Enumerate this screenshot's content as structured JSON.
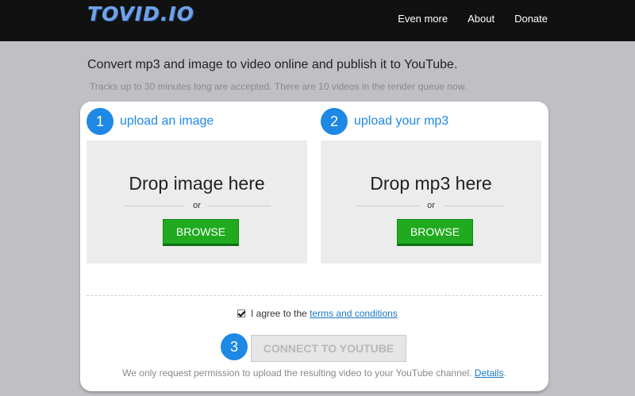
{
  "header": {
    "logo": "TOVID.IO",
    "nav": [
      "Even more",
      "About",
      "Donate"
    ]
  },
  "intro": {
    "headline": "Convert mp3 and image to video online and publish it to YouTube.",
    "subline": "Tracks up to 30 minutes long are accepted. There are 10 videos in the render queue now."
  },
  "steps": {
    "image": {
      "number": "1",
      "label": "upload an image",
      "drop_text": "Drop image here",
      "or": "or",
      "browse": "BROWSE"
    },
    "mp3": {
      "number": "2",
      "label": "upload your mp3",
      "drop_text": "Drop mp3 here",
      "or": "or",
      "browse": "BROWSE"
    },
    "publish": {
      "number": "3",
      "button": "CONNECT TO YOUTUBE"
    }
  },
  "agreement": {
    "checked": true,
    "prefix": "I agree to the",
    "link": "terms and conditions"
  },
  "note": {
    "text": "We only request permission to upload the resulting video to your YouTube channel.",
    "link": "Details",
    "suffix": "."
  },
  "colors": {
    "accent": "#1e88e5",
    "browse": "#1faa1f",
    "topbar": "#111111",
    "background": "#c0bfc4"
  }
}
